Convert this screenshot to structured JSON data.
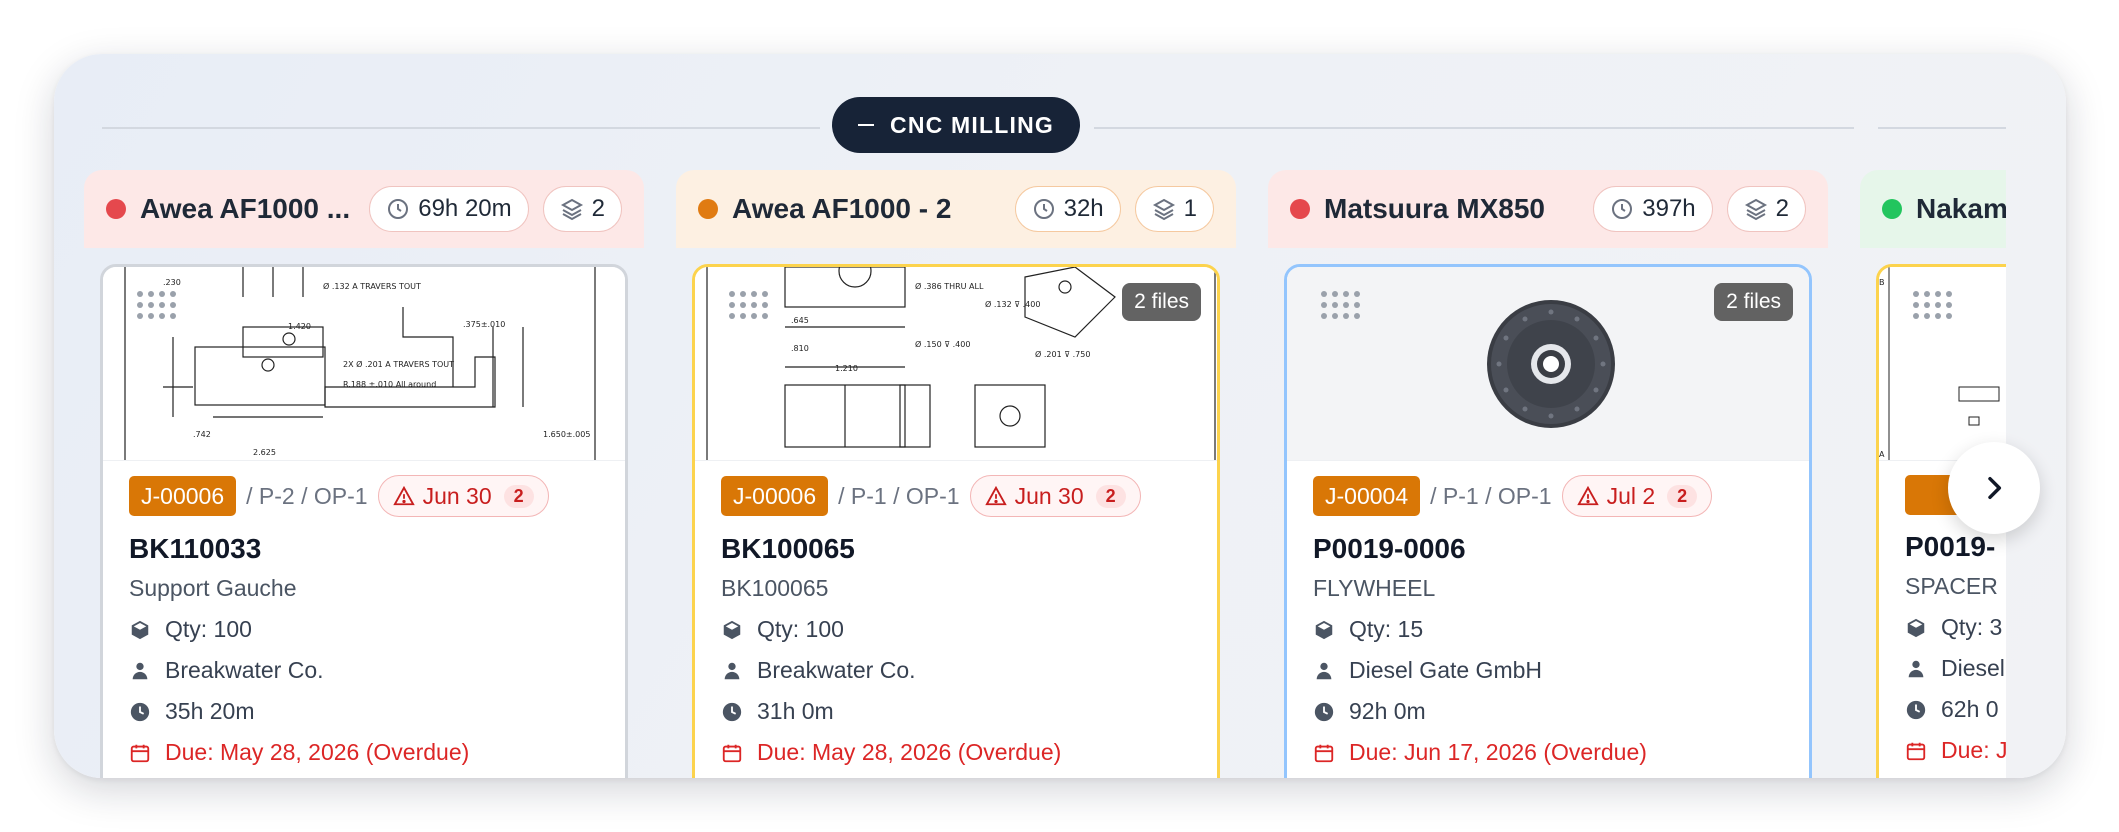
{
  "group": {
    "label": "CNC MILLING"
  },
  "columns": [
    {
      "machine": "Awea AF1000 ...",
      "status_color": "#e5484d",
      "head_bg": "#fde8e7",
      "time": "69h 20m",
      "jobs": "2",
      "card": {
        "border": "#d1d5db",
        "files": "",
        "job": "J-00006",
        "path": "/ P-2 / OP-1",
        "due_short": "Jun 30",
        "due_count": "2",
        "part_no": "BK110033",
        "part_name": "Support Gauche",
        "qty": "Qty: 100",
        "customer": "Breakwater Co.",
        "duration": "35h 20m",
        "due": "Due: May 28, 2026 (Overdue)"
      }
    },
    {
      "machine": "Awea AF1000 - 2",
      "status_color": "#e07b12",
      "head_bg": "#fdf0e2",
      "time": "32h",
      "jobs": "1",
      "card": {
        "border": "#fcd34d",
        "files": "2 files",
        "job": "J-00006",
        "path": "/ P-1 / OP-1",
        "due_short": "Jun 30",
        "due_count": "2",
        "part_no": "BK100065",
        "part_name": "BK100065",
        "qty": "Qty: 100",
        "customer": "Breakwater Co.",
        "duration": "31h 0m",
        "due": "Due: May 28, 2026 (Overdue)"
      }
    },
    {
      "machine": "Matsuura MX850",
      "status_color": "#e5484d",
      "head_bg": "#fde8e7",
      "time": "397h",
      "jobs": "2",
      "card": {
        "border": "#93c5fd",
        "files": "2 files",
        "job": "J-00004",
        "path": "/ P-1 / OP-1",
        "due_short": "Jul 2",
        "due_count": "2",
        "part_no": "P0019-0006",
        "part_name": "FLYWHEEL",
        "qty": "Qty: 15",
        "customer": "Diesel Gate GmbH",
        "duration": "92h 0m",
        "due": "Due: Jun 17, 2026 (Overdue)"
      }
    },
    {
      "machine": "Nakam",
      "status_color": "#22c55e",
      "head_bg": "#e6f6ea",
      "time": "",
      "jobs": "",
      "card": {
        "border": "#fcd34d",
        "files": "",
        "job": "",
        "path": "",
        "due_short": "",
        "due_count": "",
        "part_no": "P0019-",
        "part_name": "SPACER",
        "qty": "Qty: 3",
        "customer": "Diesel",
        "duration": "62h 0",
        "due": "Due: J"
      }
    }
  ]
}
